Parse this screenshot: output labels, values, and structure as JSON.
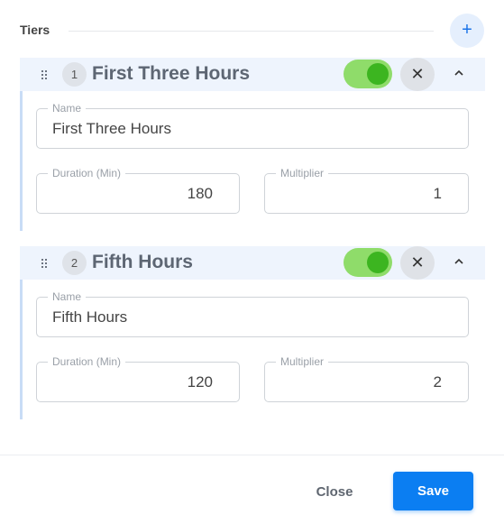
{
  "header": {
    "title": "Tiers",
    "add_icon": "plus-icon",
    "add_label": "+"
  },
  "tiers": [
    {
      "number": "1",
      "title": "First Three Hours",
      "enabled": true,
      "name_legend": "Name",
      "name_value": "First Three Hours",
      "duration_legend": "Duration (Min)",
      "duration_value": "180",
      "multiplier_legend": "Multiplier",
      "multiplier_value": "1"
    },
    {
      "number": "2",
      "title": "Fifth Hours",
      "enabled": true,
      "name_legend": "Name",
      "name_value": "Fifth Hours",
      "duration_legend": "Duration (Min)",
      "duration_value": "120",
      "multiplier_legend": "Multiplier",
      "multiplier_value": "2"
    }
  ],
  "icons": {
    "drag": "drag-handle-icon",
    "remove": "close-icon",
    "remove_glyph": "✕",
    "collapse": "chevron-up-icon"
  },
  "colors": {
    "accent": "#0b7ef2",
    "toggle_on": "#8fdc6a",
    "toggle_knob": "#3cb520"
  },
  "footer": {
    "close_label": "Close",
    "save_label": "Save"
  }
}
